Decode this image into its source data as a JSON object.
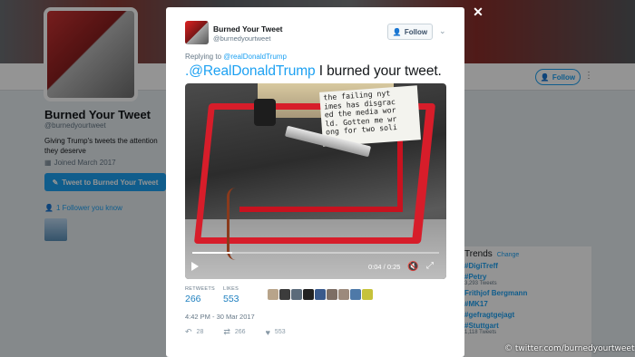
{
  "background": {
    "profile_name": "Burned Your Tweet",
    "profile_handle": "@burnedyourtweet",
    "profile_bio": "Giving Trump's tweets the attention they deserve",
    "joined": "Joined March 2017",
    "tweet_to_button": "Tweet to Burned Your Tweet",
    "followers_you_know": "1 Follower you know",
    "follow_button": "Follow",
    "trends": {
      "title": "Trends",
      "change": "Change",
      "items": [
        {
          "name": "#DigiTreff",
          "count": ""
        },
        {
          "name": "#Petry",
          "count": "3,293 Tweets"
        },
        {
          "name": "Frithjof Bergmann",
          "count": ""
        },
        {
          "name": "#MK17",
          "count": ""
        },
        {
          "name": "#gefragtgejagt",
          "count": ""
        },
        {
          "name": "#Stuttgart",
          "count": "1,118 Tweets"
        }
      ]
    }
  },
  "modal": {
    "author_name": "Burned Your Tweet",
    "author_handle": "@burnedyourtweet",
    "follow_label": "Follow",
    "replying_prefix": "Replying to",
    "replying_to": "@realDonaldTrump",
    "tweet_mention": ".@RealDonaldTrump",
    "tweet_text": " I burned your tweet.",
    "video": {
      "paper_lines": [
        "the failing nyt",
        "imes has disgrac",
        "ed the media wor",
        "ld. Gotten me wr",
        "ong for two soli"
      ],
      "time": "0:04 / 0:25",
      "progress": 0.16
    },
    "retweets_label": "RETWEETS",
    "retweets_value": "266",
    "likes_label": "LIKES",
    "likes_value": "553",
    "timestamp": "4:42 PM - 30 Mar 2017",
    "action_reply_count": "28",
    "action_retweet_count": "266",
    "action_like_count": "553"
  },
  "close_label": "✕",
  "credit": "© twitter.com/burnedyourtweet",
  "colors": {
    "accent": "#1da1f2",
    "frame_red": "#d71d2a"
  }
}
